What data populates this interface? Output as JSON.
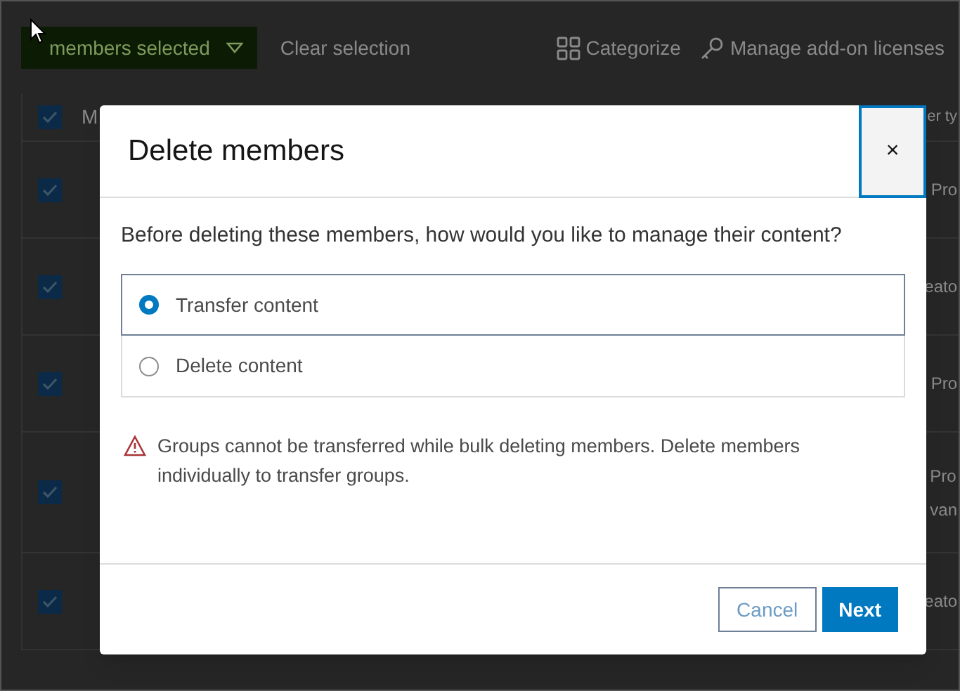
{
  "toolbar": {
    "selection_button": "members selected",
    "clear": "Clear selection",
    "actions": [
      {
        "kind": "categorize",
        "label": "Categorize"
      },
      {
        "kind": "licenses",
        "label": "Manage add-on licenses"
      }
    ]
  },
  "table": {
    "header": {
      "checked": true,
      "column_1": "M",
      "column_2": "er ty"
    },
    "rows": [
      {
        "checked": true,
        "lines": [
          "Pro"
        ]
      },
      {
        "checked": true,
        "lines": [
          "eato"
        ]
      },
      {
        "checked": true,
        "lines": [
          "Pro"
        ]
      },
      {
        "checked": true,
        "lines": [
          "Pro",
          "van"
        ]
      },
      {
        "checked": true,
        "lines": [
          "eato"
        ]
      }
    ]
  },
  "dialog": {
    "title": "Delete members",
    "close": "×",
    "question": "Before deleting these members, how would you like to manage their content?",
    "options": [
      {
        "label": "Transfer content",
        "selected": true
      },
      {
        "label": "Delete content",
        "selected": false
      }
    ],
    "warning": "Groups cannot be transferred while bulk deleting members. Delete members individually to transfer groups.",
    "buttons": [
      {
        "label": "Cancel",
        "kind": "secondary"
      },
      {
        "label": "Next",
        "kind": "primary"
      }
    ]
  }
}
